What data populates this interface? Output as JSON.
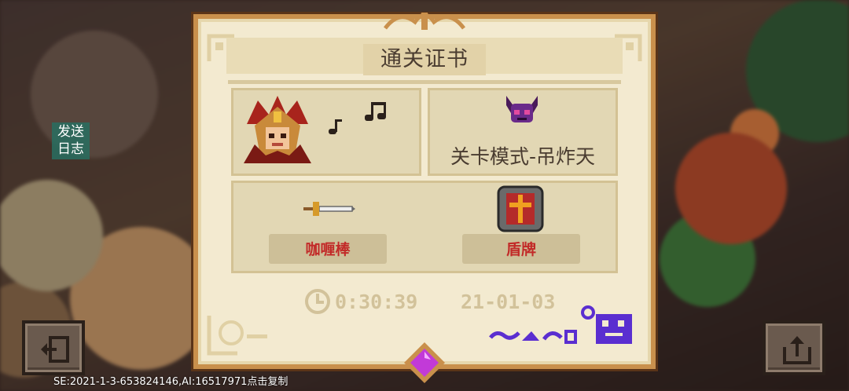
{
  "overlay": {
    "log_button": "发送\n日志",
    "log_line1": "发送",
    "log_line2": "日志",
    "footer": "SE:2021-1-3-653824146,AI:16517971点击复制"
  },
  "certificate": {
    "title": "通关证书",
    "level_mode": "关卡模式-吊炸天",
    "weapons": [
      {
        "name": "咖喱棒",
        "icon": "sword-icon"
      },
      {
        "name": "盾牌",
        "icon": "shield-icon"
      }
    ],
    "time": "0:30:39",
    "date": "21-01-03"
  },
  "icons": {
    "exit": "exit-icon",
    "share": "share-icon",
    "clock": "clock-icon",
    "boss": "horned-skull-icon",
    "hero": "hero-portrait",
    "music": "music-note-icon",
    "gem": "gem-icon"
  },
  "colors": {
    "parchment": "#f3ead0",
    "frame": "#c9904c",
    "weapon_label": "#c22a28",
    "gem": "#c23ad8",
    "signature": "#5a2ed0"
  }
}
